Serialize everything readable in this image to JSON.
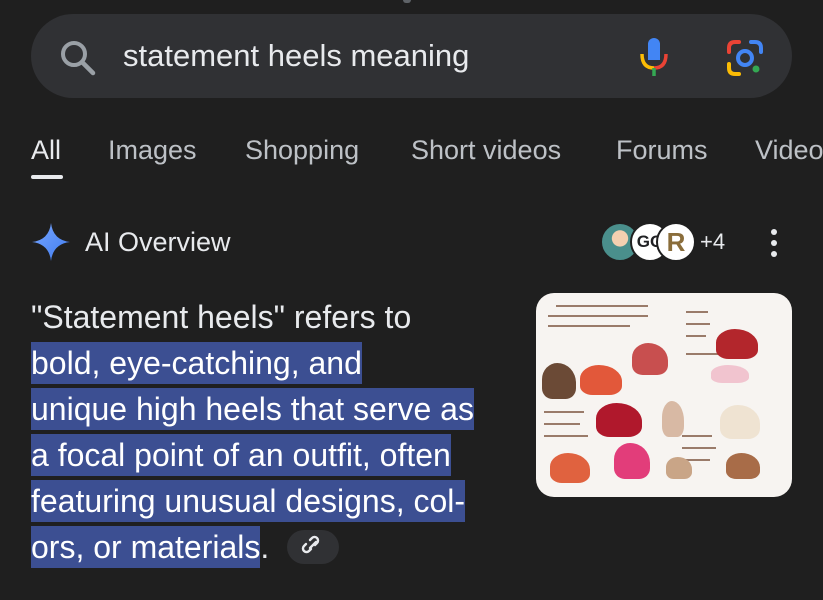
{
  "search": {
    "query": "statement heels meaning",
    "icons": [
      "search-icon",
      "microphone-icon",
      "google-lens-icon"
    ]
  },
  "tabs": [
    {
      "label": "All",
      "active": true
    },
    {
      "label": "Images"
    },
    {
      "label": "Shopping"
    },
    {
      "label": "Short videos"
    },
    {
      "label": "Forums"
    },
    {
      "label": "Videos"
    }
  ],
  "ai_overview": {
    "title": "AI Overview",
    "sources": {
      "avatar_2_text": "GO",
      "avatar_3_text": "R",
      "more_count": "+4"
    },
    "answer": {
      "plain_prefix": "\"Statement heels\" refers to",
      "highlight_line_1": "bold, eye-catching, and",
      "highlight_line_2": "unique high heels that serve as",
      "highlight_line_3": "a focal point of an outfit, often",
      "highlight_line_4": "featuring unusual designs, col-",
      "highlight_line_5": "ors, or materials",
      "suffix": "."
    }
  },
  "colors": {
    "background": "#1f1f1f",
    "search_bar": "#303134",
    "highlight": "#3c4f92",
    "sparkle": "#4f86f7"
  }
}
